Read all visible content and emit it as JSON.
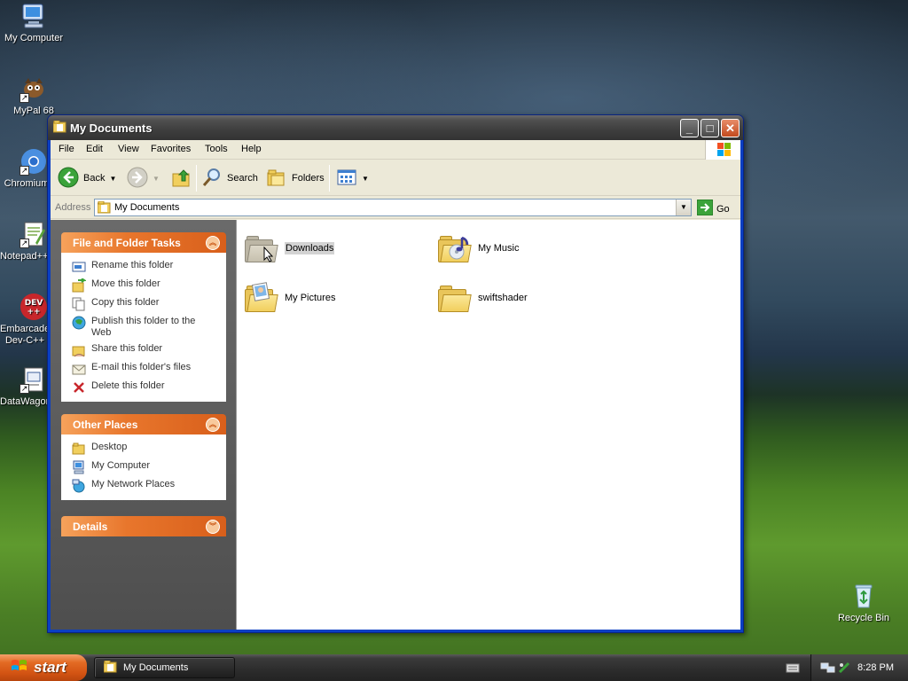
{
  "desktop": {
    "icons": [
      {
        "label": "My Computer"
      },
      {
        "label": "MyPal 68"
      },
      {
        "label": "Chromium"
      },
      {
        "label": "Notepad++"
      },
      {
        "label": "Embarcadero Dev-C++"
      },
      {
        "label": "DataWagon"
      },
      {
        "label": "Recycle Bin"
      }
    ]
  },
  "window": {
    "title": "My Documents",
    "buttons": {
      "minimize": "_",
      "maximize": "□",
      "close": "✕"
    },
    "menu": [
      "File",
      "Edit",
      "View",
      "Favorites",
      "Tools",
      "Help"
    ],
    "toolbar": {
      "back": "Back",
      "search": "Search",
      "folders": "Folders"
    },
    "address": {
      "label": "Address",
      "value": "My Documents",
      "go": "Go"
    }
  },
  "sidebar": {
    "file_tasks": {
      "title": "File and Folder Tasks",
      "items": [
        "Rename this folder",
        "Move this folder",
        "Copy this folder",
        "Publish this folder to the Web",
        "Share this folder",
        "E-mail this folder's files",
        "Delete this folder"
      ]
    },
    "other_places": {
      "title": "Other Places",
      "items": [
        "Desktop",
        "My Computer",
        "My Network Places"
      ]
    },
    "details": {
      "title": "Details"
    }
  },
  "files": [
    {
      "name": "Downloads",
      "selected": true
    },
    {
      "name": "My Music",
      "selected": false
    },
    {
      "name": "My Pictures",
      "selected": false
    },
    {
      "name": "swiftshader",
      "selected": false
    }
  ],
  "taskbar": {
    "start": "start",
    "task": "My Documents",
    "clock": "8:28 PM"
  },
  "colors": {
    "panel_header": "#e8762c",
    "window_title": "#4f4f4f",
    "selection": "#d3d3d3"
  }
}
